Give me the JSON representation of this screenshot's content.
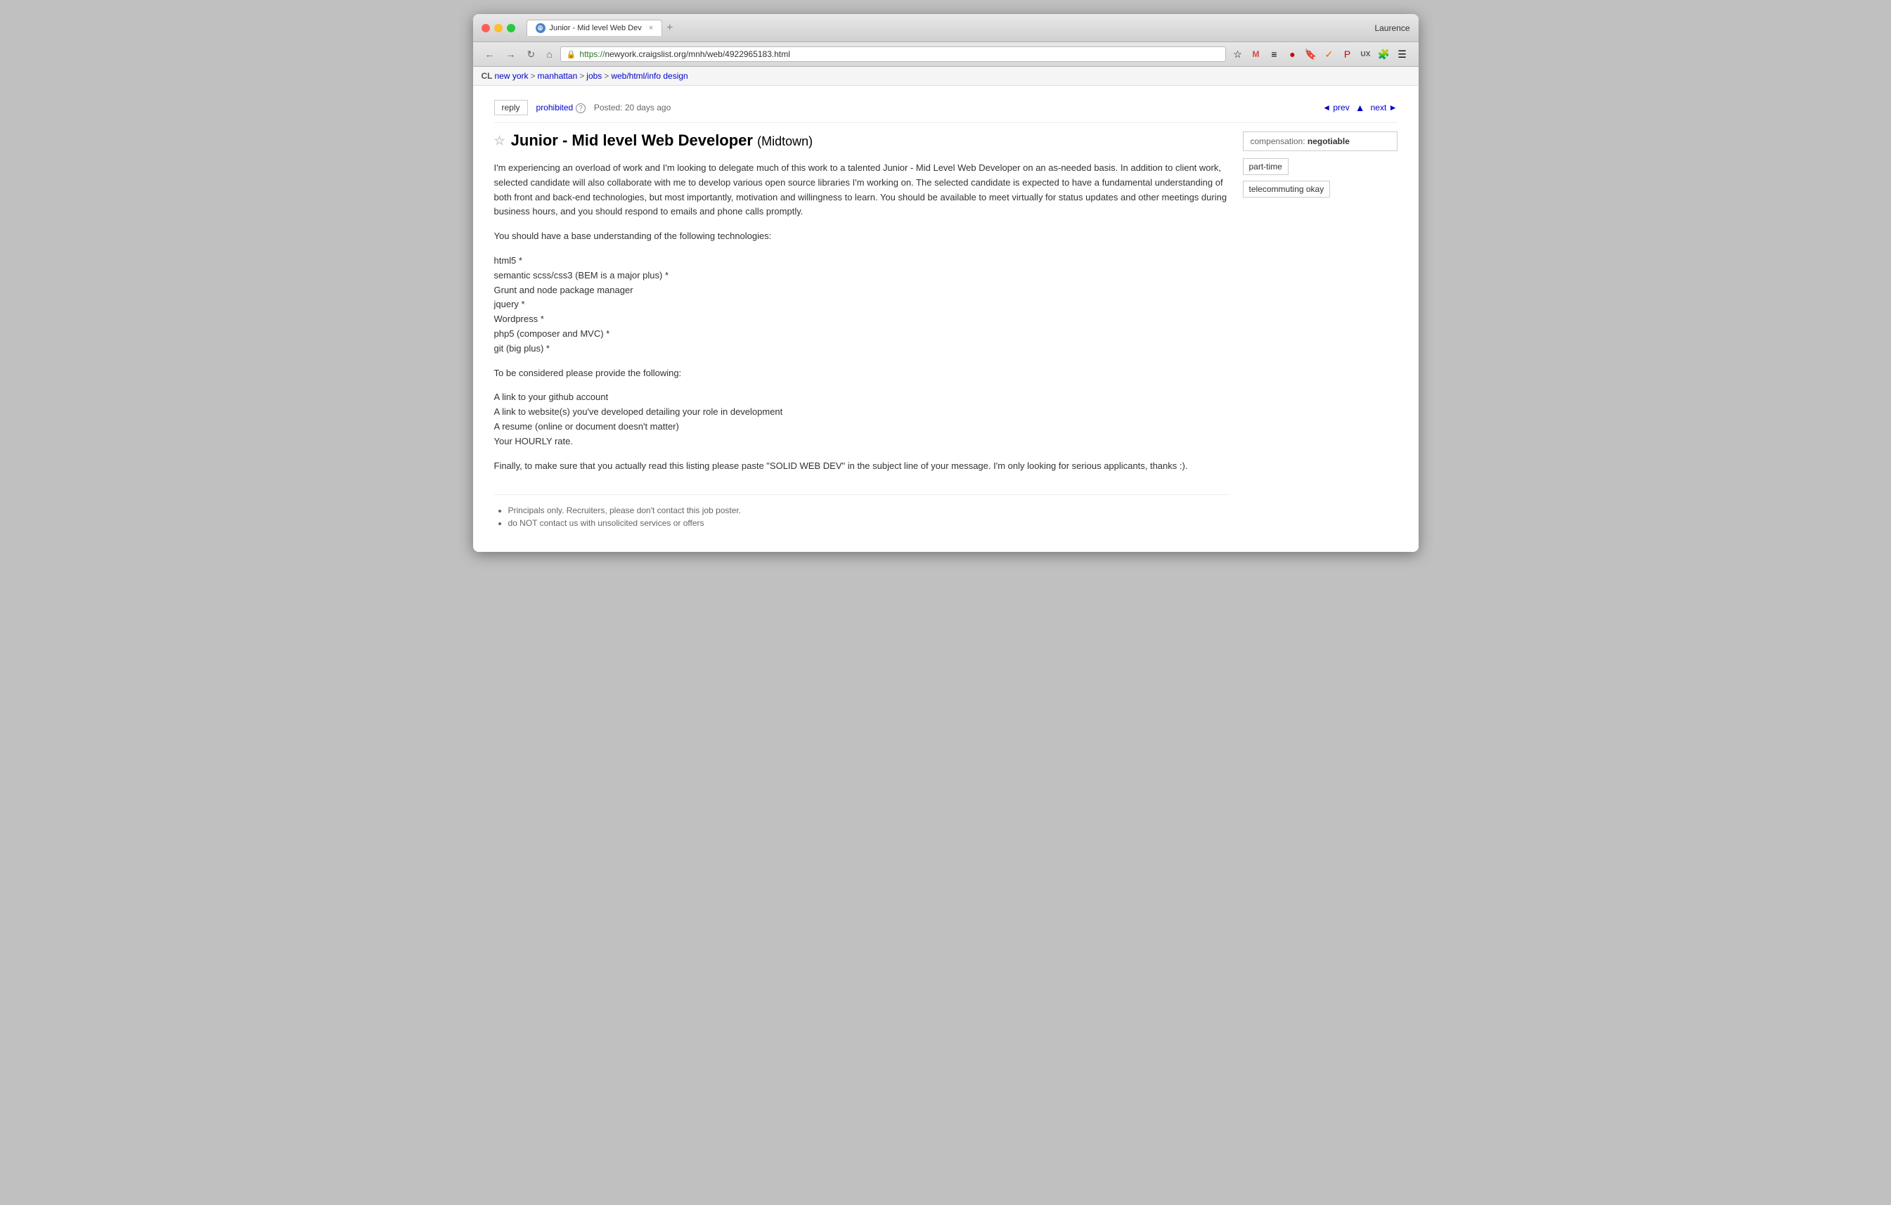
{
  "browser": {
    "tab_title": "Junior - Mid level Web Dev",
    "tab_close": "×",
    "new_tab": "+",
    "url": "https://newyork.craigslist.org/mnh/web/4922965183.html",
    "url_https": "https://",
    "url_domain": "newyork.craigslist.org",
    "url_path": "/mnh/web/4922965183.html",
    "user_name": "Laurence"
  },
  "breadcrumb": {
    "cl": "CL",
    "new_york": "new york",
    "manhattan": "manhattan",
    "jobs": "jobs",
    "category": "web/html/info design"
  },
  "toolbar_actions": {
    "reply": "reply",
    "prohibited": "prohibited",
    "question_mark": "?",
    "posted": "Posted: 20 days ago",
    "prev": "◄ prev",
    "next": "next ►"
  },
  "post": {
    "title": "Junior - Mid level Web Developer",
    "location": "(Midtown)",
    "body_paragraphs": [
      "I'm experiencing an overload of work and I'm looking to delegate much of this work to a talented Junior - Mid Level Web Developer on an as-needed basis. In addition to client work, selected candidate will also collaborate with me to develop various open source libraries I'm working on. The selected candidate is expected to have a fundamental understanding of both front and back-end technologies, but most importantly, motivation and willingness to learn. You should be available to meet virtually for status updates and other meetings during business hours, and you should respond to emails and phone calls promptly.",
      "You should have a base understanding of the following technologies:",
      "html5 *\nsemantic scss/css3 (BEM is a major plus) *\nGrunt and node package manager\njquery *\nWordpress *\nphp5 (composer and MVC) *\ngit (big plus) *",
      "To be considered please provide the following:",
      "A link to your github account\nA link to website(s) you've developed detailing your role in development\nA resume (online or document doesn't matter)\nYour HOURLY rate.",
      "Finally, to make sure that you actually read this listing please paste \"SOLID WEB DEV\" in the subject line of your message. I'm only looking for serious applicants, thanks :)."
    ],
    "technologies": [
      "html5 *",
      "semantic scss/css3 (BEM is a major plus) *",
      "Grunt and node package manager",
      "jquery *",
      "Wordpress *",
      "php5 (composer and MVC) *",
      "git (big plus) *"
    ],
    "requirements": [
      "A link to your github account",
      "A link to website(s) you've developed detailing your role in development",
      "A resume (online or document doesn't matter)",
      "Your HOURLY rate."
    ],
    "footer_notes": [
      "Principals only. Recruiters, please don't contact this job poster.",
      "do NOT contact us with unsolicited services or offers"
    ]
  },
  "sidebar": {
    "compensation_label": "compensation:",
    "compensation_value": "negotiable",
    "tag1": "part-time",
    "tag2": "telecommuting okay"
  }
}
